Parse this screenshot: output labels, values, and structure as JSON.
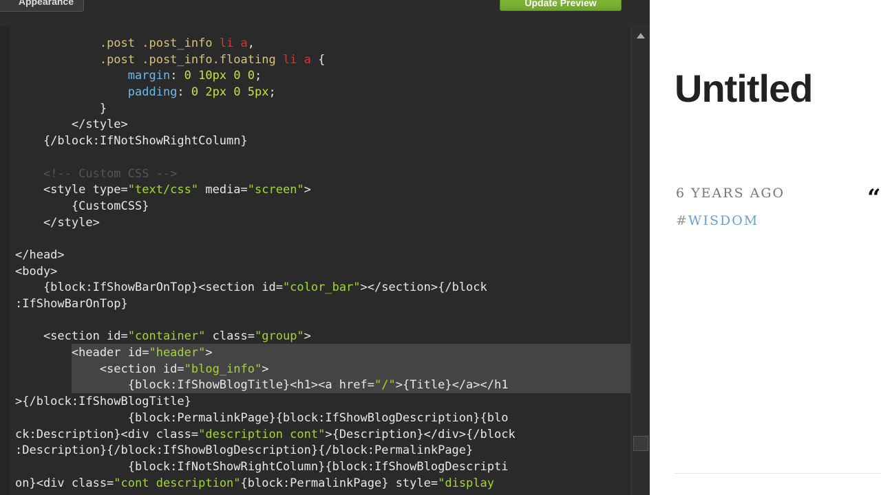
{
  "toolbar": {
    "appearance_label": "Appearance",
    "update_label": "Update Preview"
  },
  "editor": {
    "lines": [
      [
        {
          "t": "            "
        },
        {
          "c": "cls",
          "t": ".post .post_info "
        },
        {
          "c": "red",
          "t": "li a"
        },
        {
          "t": ","
        }
      ],
      [
        {
          "t": "            "
        },
        {
          "c": "cls",
          "t": ".post .post_info.floating "
        },
        {
          "c": "red",
          "t": "li a"
        },
        {
          "t": " {"
        }
      ],
      [
        {
          "t": "                "
        },
        {
          "c": "prop",
          "t": "margin"
        },
        {
          "t": ": "
        },
        {
          "c": "num",
          "t": "0 10px 0 0"
        },
        {
          "t": ";"
        }
      ],
      [
        {
          "t": "                "
        },
        {
          "c": "prop",
          "t": "padding"
        },
        {
          "t": ": "
        },
        {
          "c": "num",
          "t": "0 2px 0 5px"
        },
        {
          "t": ";"
        }
      ],
      [
        {
          "t": "            }"
        }
      ],
      [
        {
          "t": "        </style>"
        }
      ],
      [
        {
          "t": "    {/block:IfNotShowRightColumn}"
        }
      ],
      [
        {
          "t": ""
        }
      ],
      [
        {
          "t": "    "
        },
        {
          "c": "cm",
          "t": "<!-- Custom CSS -->"
        }
      ],
      [
        {
          "t": "    <style type="
        },
        {
          "c": "str",
          "t": "\"text/css\""
        },
        {
          "t": " media="
        },
        {
          "c": "str",
          "t": "\"screen\""
        },
        {
          "t": ">"
        }
      ],
      [
        {
          "t": "        {CustomCSS}"
        }
      ],
      [
        {
          "t": "    </style>"
        }
      ],
      [
        {
          "t": ""
        }
      ],
      [
        {
          "t": "</head>"
        }
      ],
      [
        {
          "t": "<body>"
        }
      ],
      [
        {
          "t": "    {block:IfShowBarOnTop}<section id="
        },
        {
          "c": "str",
          "t": "\"color_bar\""
        },
        {
          "t": "></section>{/block"
        }
      ],
      [
        {
          "t": ":IfShowBarOnTop}"
        }
      ],
      [
        {
          "t": ""
        }
      ],
      [
        {
          "t": "    <section id="
        },
        {
          "c": "str",
          "t": "\"container\""
        },
        {
          "t": " class="
        },
        {
          "c": "str",
          "t": "\"group\""
        },
        {
          "t": ">"
        }
      ],
      [
        {
          "t": "        <header id="
        },
        {
          "c": "str",
          "t": "\"header\""
        },
        {
          "t": ">"
        }
      ],
      [
        {
          "t": "            <section id="
        },
        {
          "c": "str",
          "t": "\"blog_info\""
        },
        {
          "t": ">"
        }
      ],
      [
        {
          "t": "                {block:IfShowBlogTitle}<h1><a href="
        },
        {
          "c": "str",
          "t": "\"/\""
        },
        {
          "t": ">{Title}</a></h1"
        }
      ],
      [
        {
          "t": ">{/block:IfShowBlogTitle}"
        }
      ],
      [
        {
          "t": "                {block:PermalinkPage}{block:IfShowBlogDescription}{blo"
        }
      ],
      [
        {
          "t": "ck:Description}<div class="
        },
        {
          "c": "str",
          "t": "\"description cont\""
        },
        {
          "t": ">{Description}</div>{/block"
        }
      ],
      [
        {
          "t": ":Description}{/block:IfShowBlogDescription}{/block:PermalinkPage}"
        }
      ],
      [
        {
          "t": "                {block:IfNotShowRightColumn}{block:IfShowBlogDescripti"
        }
      ],
      [
        {
          "t": "on}<div class="
        },
        {
          "c": "str",
          "t": "\"cont description\""
        },
        {
          "t": "{block:PermalinkPage} style="
        },
        {
          "c": "str",
          "t": "\"display"
        }
      ]
    ]
  },
  "preview": {
    "title": "Untitled",
    "date": "6 YEARS AGO",
    "tag_hash": "#",
    "tag": "WISDOM",
    "quote_glyph": "“"
  }
}
